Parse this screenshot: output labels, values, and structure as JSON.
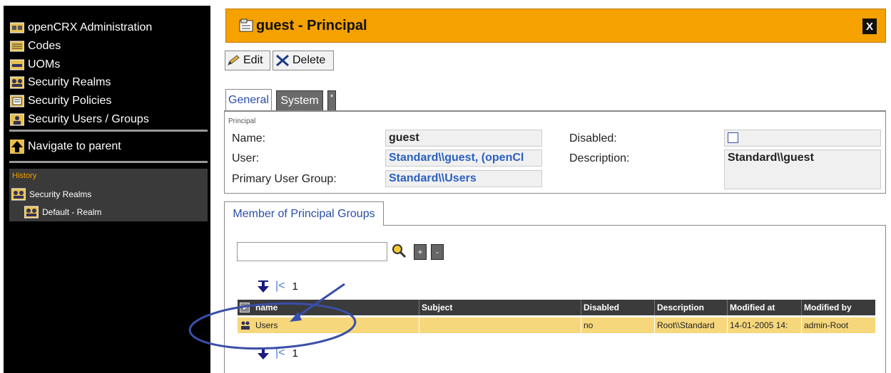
{
  "sidebar": {
    "items": [
      {
        "label": "openCRX Administration",
        "icon": "admin-icon"
      },
      {
        "label": "Codes",
        "icon": "codes-icon"
      },
      {
        "label": "UOMs",
        "icon": "uoms-icon"
      },
      {
        "label": "Security Realms",
        "icon": "realms-icon"
      },
      {
        "label": "Security Policies",
        "icon": "policies-icon"
      },
      {
        "label": "Security Users / Groups",
        "icon": "users-groups-icon"
      }
    ],
    "navigate_parent": "Navigate to parent",
    "history": {
      "title": "History",
      "items": [
        "Security Realms",
        "Default - Realm"
      ]
    }
  },
  "header": {
    "title": "guest - Principal",
    "close": "X"
  },
  "toolbar": {
    "edit_label": "Edit",
    "delete_label": "Delete"
  },
  "tabs": {
    "general": "General",
    "system": "System",
    "more": "*"
  },
  "principal": {
    "caption": "Principal",
    "name_label": "Name:",
    "name_value": "guest",
    "user_label": "User:",
    "user_value": "Standard\\\\guest, (openCl",
    "group_label": "Primary User Group:",
    "group_value": "Standard\\\\Users",
    "disabled_label": "Disabled:",
    "disabled_checked": false,
    "description_label": "Description:",
    "description_value": "Standard\\\\guest"
  },
  "members": {
    "tab_label": "Member of Principal Groups",
    "search_value": "",
    "add_label": "+",
    "remove_label": "-",
    "page_first": "|<",
    "page_number": "1",
    "columns": [
      "name",
      "Subject",
      "Disabled",
      "Description",
      "Modified at",
      "Modified by"
    ],
    "rows": [
      {
        "name": "Users",
        "subject": "",
        "disabled": "no",
        "description": "Root\\\\Standard",
        "modified_at": "14-01-2005 14:",
        "modified_by": "admin-Root"
      }
    ]
  },
  "colors": {
    "accent": "#f5a100",
    "sidebar_bg": "#000000",
    "row_highlight": "#f6d77c",
    "annotation": "#3a4fa8",
    "link": "#2a5fc0"
  }
}
